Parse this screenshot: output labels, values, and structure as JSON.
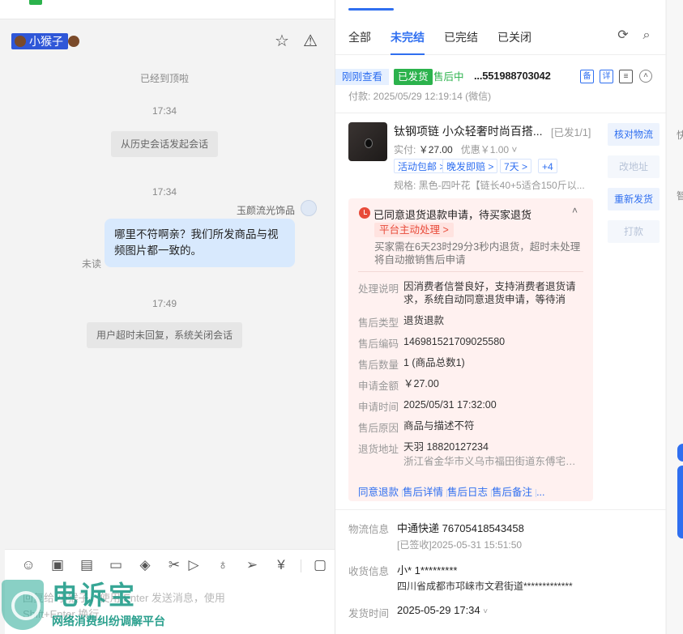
{
  "chat": {
    "customer_name": "小猴子",
    "sys_top": "已经到顶啦",
    "time1": "17:34",
    "history_pill": "从历史会话发起会话",
    "time2": "17:34",
    "sender_name": "玉颜流光饰品",
    "message": "哪里不符啊亲？我们所发商品与视频图片都一致的。",
    "unread": "未读",
    "time3": "17:49",
    "close_pill": "用户超时未回复，系统关闭会话",
    "input_placeholder": "回复给 小猴子，使用 Enter 发送消息，使用 Shift+Enter 换行"
  },
  "watermark": {
    "title": "电诉宝",
    "subtitle": "网络消费纠纷调解平台"
  },
  "orders": {
    "tabs": [
      "全部",
      "未完结",
      "已完结",
      "已关闭"
    ],
    "active_tab": "未完结",
    "recent_tag": "刚刚查看",
    "shipped_tag": "已发货",
    "aftersale_tag": "售后中",
    "order_no": "...551988703042",
    "btn_note": "备",
    "btn_detail": "详",
    "paid_time": "付款: 2025/05/29 12:19:14 (微信)",
    "product": {
      "title": "钛钢项链 小众轻奢时尚百搭...",
      "count": "[已发1/1]",
      "actual_label": "实付:",
      "actual_price": "￥27.00",
      "discount": "优惠￥1.00",
      "chips": [
        "活动包邮 >",
        "晚发即赔 >",
        "7天 >",
        "+4"
      ],
      "spec": "规格: 黑色-四叶花【链长40+5适合150斤以..."
    },
    "side_buttons": [
      "核对物流",
      "改地址",
      "重新发货",
      "打款"
    ],
    "refund": {
      "status": "已同意退货退款申请，待买家退货",
      "platform_tag": "平台主动处理 >",
      "desc": "买家需在6天23时29分3秒内退货，超时未处理将自动撤销售后申请",
      "fields": [
        {
          "label": "处理说明",
          "value": "因消费者信誉良好，支持消费者退货请求，系统自动同意退货申请，等待消费..."
        },
        {
          "label": "售后类型",
          "value": "退货退款"
        },
        {
          "label": "售后编码",
          "value": "146981521709025580"
        },
        {
          "label": "售后数量",
          "value": "1 (商品总数1)"
        },
        {
          "label": "申请金额",
          "value": "￥27.00"
        },
        {
          "label": "申请时间",
          "value": "2025/05/31 17:32:00"
        },
        {
          "label": "售后原因",
          "value": "商品与描述不符"
        },
        {
          "label": "退货地址",
          "value": "天羽 18820127234"
        }
      ],
      "address_sub": "浙江省金华市义乌市福田街道东傅宅二...",
      "actions": [
        "同意退款",
        "售后详情",
        "售后日志",
        "售后备注",
        "..."
      ]
    },
    "logistics_label": "物流信息",
    "logistics_val": "中通快递 76705418543458",
    "logistics_sub": "[已签收]2025-05-31 15:51:50",
    "receiver_label": "收货信息",
    "receiver_name": "小* 1*********",
    "receiver_addr": "四川省成都市邛崃市文君街道*************",
    "ship_label": "发货时间",
    "ship_val": "2025-05-29 17:34"
  },
  "strip": {
    "t1": "快",
    "t2": "智"
  },
  "icons": {
    "star": "star-icon",
    "warning": "warning-icon",
    "refresh": "refresh-icon",
    "search": "search-icon"
  },
  "colors": {
    "accent": "#2f6ff0",
    "shipped_green": "#2bb24c",
    "refund_red": "#e84b3a"
  }
}
